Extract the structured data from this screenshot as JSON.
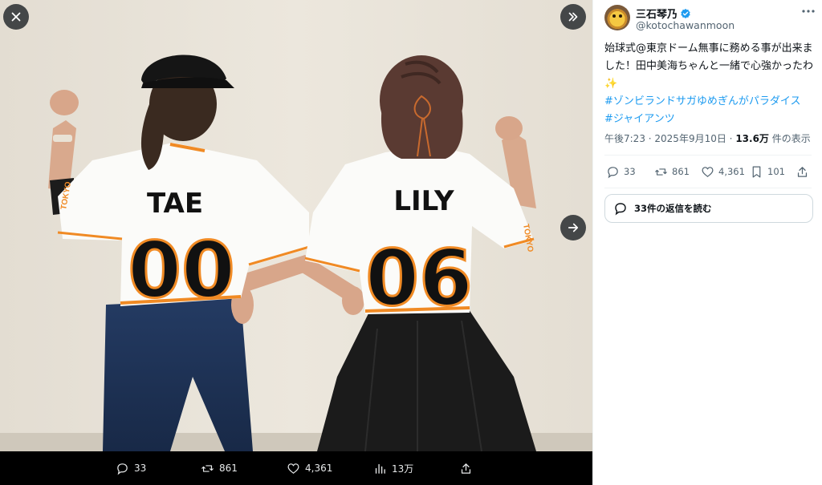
{
  "viewer": {
    "photo_jersey_left_name": "TAE",
    "photo_jersey_left_number": "00",
    "photo_jersey_right_name": "LILY",
    "photo_jersey_right_number": "06",
    "sleeve_text": "TOKYO",
    "media_bar": {
      "replies": "33",
      "reposts": "861",
      "likes": "4,361",
      "views": "13万"
    }
  },
  "tweet": {
    "display_name": "三石琴乃",
    "handle": "@kotochawanmoon",
    "text_line1": "始球式@東京ドーム無事に務める事が出来ました！田中美海ちゃんと一緒で心強かったわ",
    "sparkle": "✨",
    "hashtags": [
      "#ゾンビランドサガゆめぎんがパラダイス",
      "#ジャイアンツ"
    ],
    "time": "午後7:23",
    "date": "2025年9月10日",
    "views_count": "13.6万",
    "views_label": "件の表示",
    "replies": "33",
    "reposts": "861",
    "likes": "4,361",
    "bookmarks": "101",
    "read_replies_label": "33件の返信を読む"
  },
  "colors": {
    "accent": "#1d9bf0",
    "verified": "#1d9bf0",
    "jersey_orange": "#f08a24"
  },
  "icons": [
    "close-icon",
    "expand-icon",
    "next-arrow-icon",
    "reply-icon",
    "repost-icon",
    "like-icon",
    "views-icon",
    "share-icon",
    "bookmark-icon",
    "more-icon",
    "verified-badge-icon",
    "reply-bubble-icon"
  ]
}
